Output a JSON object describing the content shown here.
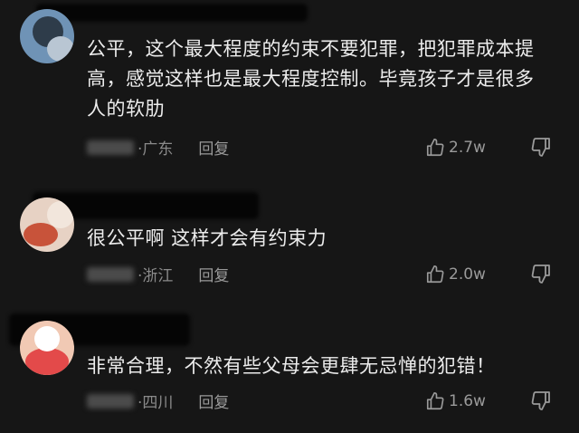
{
  "comments": [
    {
      "text": "公平，这个最大程度的约束不要犯罪，把犯罪成本提高，感觉这样也是最大程度控制。毕竟孩子才是很多人的软肋",
      "location": "·广东",
      "reply_label": "回复",
      "likes": "2.7w",
      "avatar_colors": [
        "#7fa6c9",
        "#2e3c4a",
        "#b9c6d3"
      ]
    },
    {
      "text": "很公平啊 这样才会有约束力",
      "location": "·浙江",
      "reply_label": "回复",
      "likes": "2.0w",
      "avatar_colors": [
        "#e7d2c4",
        "#c8533a",
        "#f2e6dc"
      ]
    },
    {
      "text": "非常合理，不然有些父母会更肆无忌惮的犯错！",
      "location": "·四川",
      "reply_label": "回复",
      "likes": "1.6w",
      "avatar_colors": [
        "#e34a4a",
        "#f1c9b4",
        "#ffffff"
      ]
    }
  ]
}
